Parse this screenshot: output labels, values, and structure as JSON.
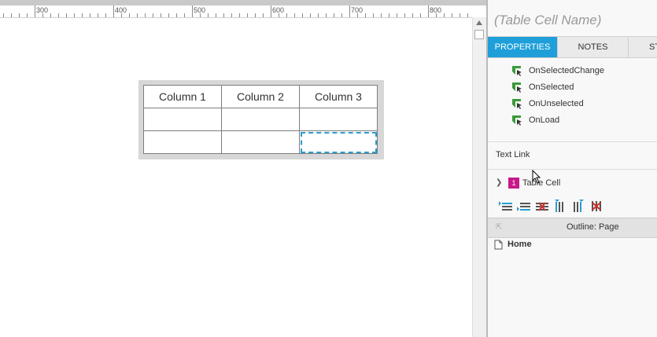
{
  "ruler": {
    "labels": [
      "300",
      "400",
      "500",
      "600",
      "700",
      "800"
    ]
  },
  "table": {
    "header": [
      "Column 1",
      "Column 2",
      "Column 3"
    ],
    "rows": [
      [
        "",
        "",
        ""
      ],
      [
        "",
        "",
        ""
      ]
    ]
  },
  "panel": {
    "title": "(Table Cell Name)",
    "tabs": [
      "PROPERTIES",
      "NOTES",
      "ST"
    ],
    "events": [
      "OnSelectedChange",
      "OnSelected",
      "OnUnselected",
      "OnLoad"
    ],
    "text_link": "Text Link",
    "cell_section": {
      "badge": "1",
      "label": "Table Cell"
    },
    "outline": {
      "title": "Outline: Page",
      "page": "Home"
    }
  },
  "colors": {
    "accent": "#1e9fd9",
    "badge": "#c61a8a",
    "event_icon": "#3a9a3a"
  }
}
